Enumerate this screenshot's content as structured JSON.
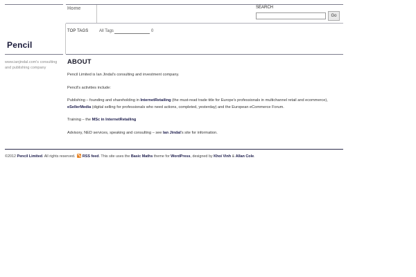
{
  "nav": {
    "home_label": "Home"
  },
  "search": {
    "label": "SEARCH",
    "value": "",
    "button_label": "Go"
  },
  "tags": {
    "label": "TOP TAGS",
    "all_tags_label": "All Tags",
    "count": "0"
  },
  "site": {
    "title": "Pencil",
    "description": "www.ianjindal.com's consulting and publishing company"
  },
  "page": {
    "heading": "ABOUT",
    "intro": "Pencil Limited is Ian Jindal's consulting and investment company.",
    "activities_intro": "Pencil's activities include:",
    "publishing": {
      "prefix": "Publishing – founding and shareholding in ",
      "link1": "InternetRetailing",
      "middle": " (the must-read trade title for Europe's professionals in multichannel retail and ecommerce), ",
      "link2": "eSellerMedia",
      "suffix": " (digital selling for professionals who need actions, completed, yesterday) and the European eCommerce Forum."
    },
    "training": {
      "prefix": "Training – the ",
      "link": "MSc in InternetRetailing",
      "suffix": ""
    },
    "advisory": {
      "prefix": "Advisory, NED services, speaking and consulting – see ",
      "link": "Ian Jindal",
      "suffix": "'s site for information."
    }
  },
  "footer": {
    "copyright": "©2012 ",
    "company_link": "Pencil Limited",
    "rights": ". All rights reserved. ",
    "rss_label": "RSS feed",
    "theme_prefix": ". This site uses the ",
    "theme_link": "Basic Maths",
    "theme_middle": " theme for ",
    "wp_link": "WordPress",
    "designed_by": ", designed by ",
    "designer1": "Khoi Vinh",
    "amp": " & ",
    "designer2": "Allan Cole",
    "end": "."
  },
  "icons": {
    "rss": "rss-icon"
  },
  "colors": {
    "rule": "#7c7c8c",
    "rule_dark": "#2a2a4a",
    "link": "#1a1a4a",
    "rss": "#e8862a"
  }
}
